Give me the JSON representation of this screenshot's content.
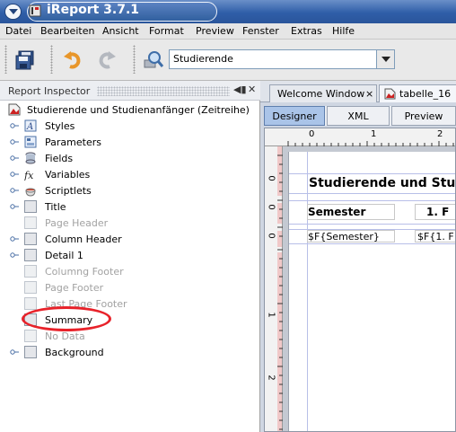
{
  "window": {
    "title": "iReport 3.7.1"
  },
  "menu": [
    "Datei",
    "Bearbeiten",
    "Ansicht",
    "Format",
    "Preview",
    "Fenster",
    "Extras",
    "Hilfe"
  ],
  "toolbar": {
    "datasource_value": "Studierende"
  },
  "inspector": {
    "title": "Report Inspector",
    "root": "Studierende und Studienanfänger (Zeitreihe)",
    "nodes": [
      {
        "label": "Styles",
        "expandable": true,
        "enabled": true,
        "icon": "styles-icon"
      },
      {
        "label": "Parameters",
        "expandable": true,
        "enabled": true,
        "icon": "parameters-icon"
      },
      {
        "label": "Fields",
        "expandable": true,
        "enabled": true,
        "icon": "fields-icon"
      },
      {
        "label": "Variables",
        "expandable": true,
        "enabled": true,
        "icon": "variables-icon"
      },
      {
        "label": "Scriptlets",
        "expandable": true,
        "enabled": true,
        "icon": "scriptlets-icon"
      },
      {
        "label": "Title",
        "expandable": true,
        "enabled": true,
        "icon": "band-icon"
      },
      {
        "label": "Page Header",
        "expandable": false,
        "enabled": false,
        "icon": "band-icon"
      },
      {
        "label": "Column Header",
        "expandable": true,
        "enabled": true,
        "icon": "band-icon"
      },
      {
        "label": "Detail 1",
        "expandable": true,
        "enabled": true,
        "icon": "band-icon"
      },
      {
        "label": "Columng Footer",
        "expandable": false,
        "enabled": false,
        "icon": "band-icon"
      },
      {
        "label": "Page Footer",
        "expandable": false,
        "enabled": false,
        "icon": "band-icon"
      },
      {
        "label": "Last Page Footer",
        "expandable": false,
        "enabled": false,
        "icon": "band-icon"
      },
      {
        "label": "Summary",
        "expandable": false,
        "enabled": true,
        "icon": "band-icon"
      },
      {
        "label": "No Data",
        "expandable": false,
        "enabled": false,
        "icon": "band-icon"
      },
      {
        "label": "Background",
        "expandable": true,
        "enabled": true,
        "icon": "band-icon"
      }
    ]
  },
  "editor": {
    "tabs": [
      {
        "label": "Welcome Window",
        "close": "×"
      },
      {
        "label": "tabelle_16"
      }
    ],
    "views": [
      "Designer",
      "XML",
      "Preview"
    ],
    "ruler_h": [
      "0",
      "1",
      "2"
    ],
    "ruler_v": [
      "0",
      "0",
      "0",
      "1",
      "2"
    ],
    "report": {
      "title": "Studierende und Stu",
      "header_semester": "Semester",
      "header_col2": "1. F",
      "field_semester": "$F{Semester}",
      "field_col2": "$F{1. F"
    }
  },
  "colors": {
    "titlebar": "#2f5ea8",
    "highlight_ellipse": "#e8222a",
    "selected_view": "#aac4e8"
  }
}
